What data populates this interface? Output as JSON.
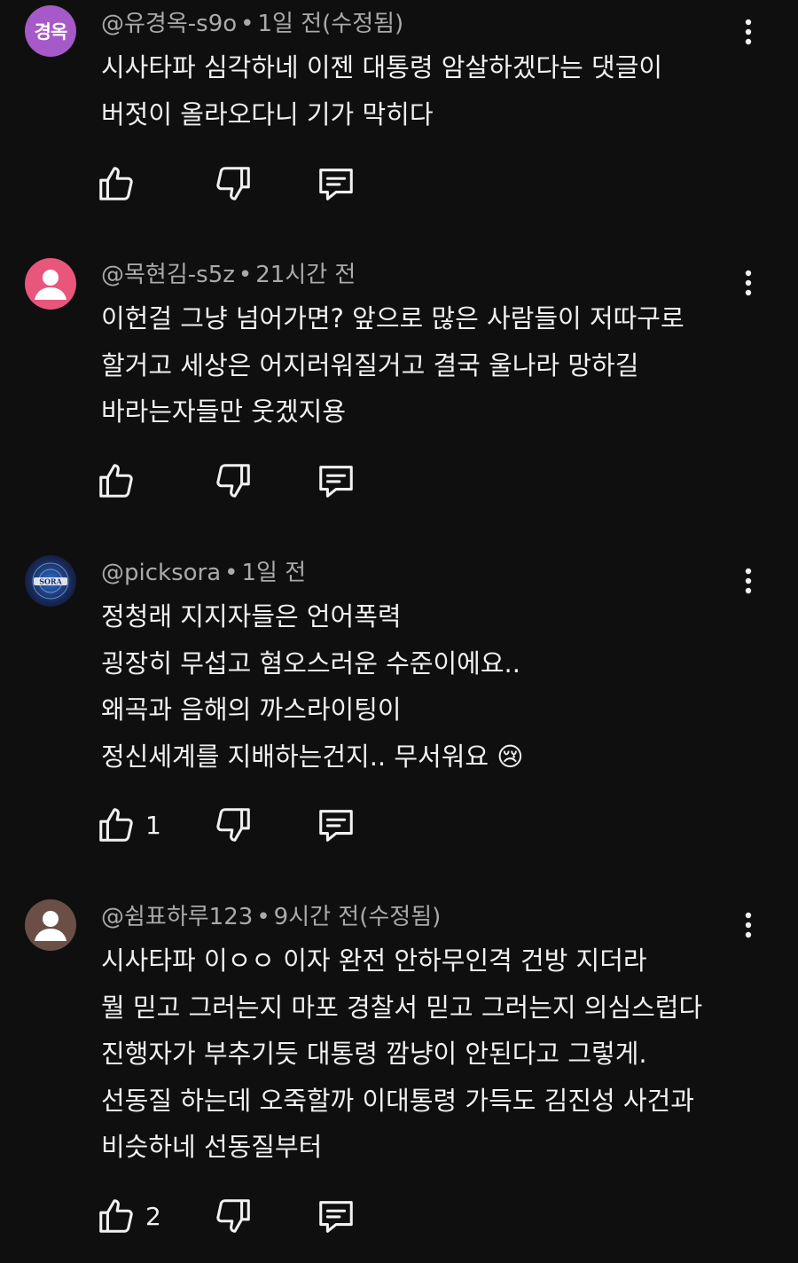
{
  "comments": [
    {
      "avatar_initials": "경옥",
      "avatar_color": "#a659c9",
      "author": "@유경옥-s9o",
      "time": "1일 전(수정됨)",
      "lines": [
        "시사타파 심각하네 이젠 대통령 암살하겠다는 댓글이",
        "버젓이 올라오다니 기가 막히다"
      ],
      "likes": ""
    },
    {
      "avatar_initials": "",
      "avatar_color": "#e8567c",
      "author": "@목현김-s5z",
      "time": "21시간 전",
      "lines": [
        "이헌걸 그냥 넘어가면? 앞으로 많은 사람들이 저따구로",
        "할거고 세상은 어지러워질거고 결국 울나라 망하길",
        "바라는자들만 웃겠지용"
      ],
      "likes": ""
    },
    {
      "avatar_initials": "SORA",
      "avatar_color": "#1a2a5a",
      "author": "@picksora",
      "time": "1일 전",
      "lines": [
        "정청래 지지자들은 언어폭력",
        "굉장히 무섭고 혐오스러운 수준이에요..",
        "왜곡과 음해의 까스라이팅이",
        "정신세계를 지배하는건지.. 무서워요 😢"
      ],
      "likes": "1"
    },
    {
      "avatar_initials": "",
      "avatar_color": "#6b4f47",
      "author": "@쉼표하루123",
      "time": "9시간 전(수정됨)",
      "lines": [
        "시사타파 이ㅇㅇ 이자 완전 안하무인격  건방 지더라",
        "뭘 믿고 그러는지 마포 경찰서 믿고 그러는지 의심스럽다",
        "진행자가 부추기듯 대통령 깜냥이  안된다고 그렇게.",
        "선동질 하는데 오죽할까 이대통령 가득도 김진성 사건과",
        "비슷하네 선동질부터"
      ],
      "likes": "2"
    }
  ]
}
